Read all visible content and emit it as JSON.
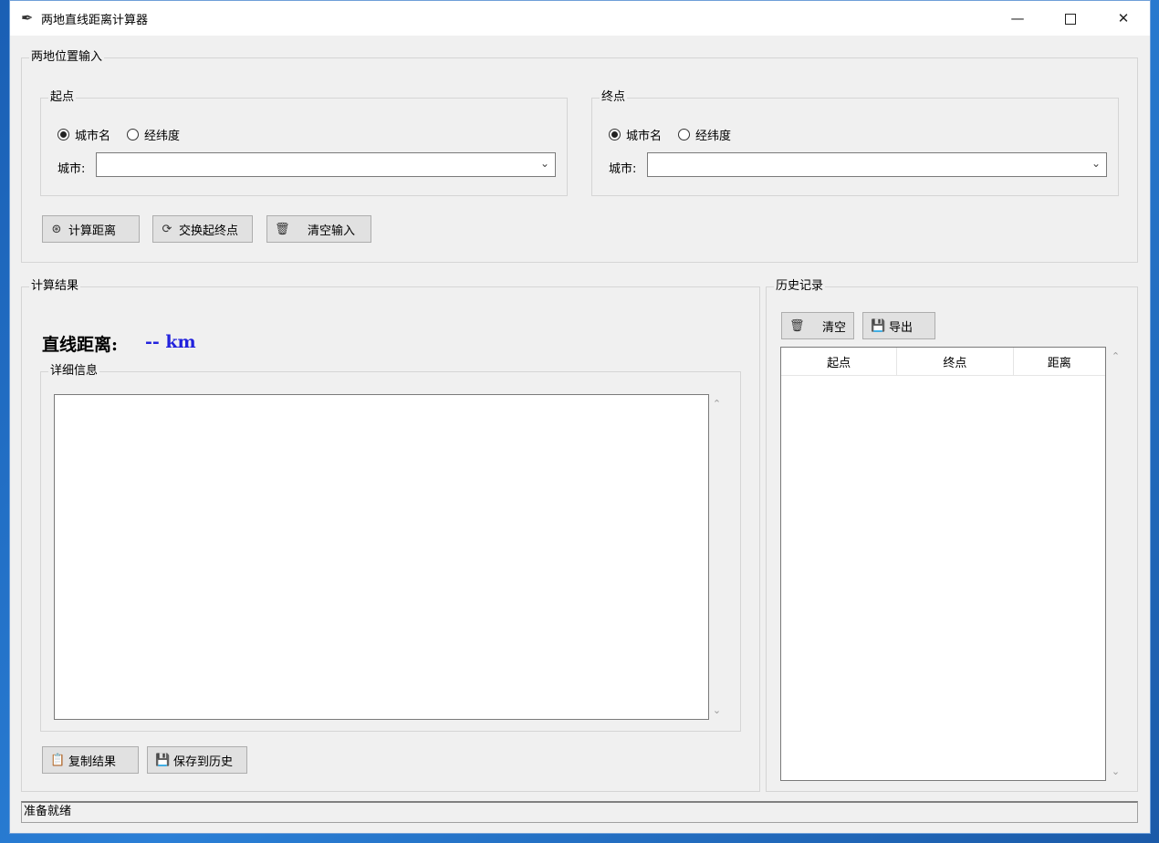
{
  "window": {
    "title": "两地直线距离计算器",
    "controls": {
      "minimize": "—",
      "maximize": "□",
      "close": "✕"
    }
  },
  "input_section": {
    "legend": "两地位置输入",
    "start": {
      "legend": "起点",
      "radio_city": "城市名",
      "radio_coords": "经纬度",
      "selected_mode": "城市名",
      "field_label": "城市:",
      "value": ""
    },
    "end": {
      "legend": "终点",
      "radio_city": "城市名",
      "radio_coords": "经纬度",
      "selected_mode": "城市名",
      "field_label": "城市:",
      "value": ""
    },
    "buttons": {
      "calculate": "计算距离",
      "swap": "交换起终点",
      "clear": "清空输入"
    }
  },
  "result_section": {
    "legend": "计算结果",
    "distance_label": "直线距离:",
    "distance_value": "-- km",
    "details_legend": "详细信息",
    "details_text": "",
    "buttons": {
      "copy": "复制结果",
      "save": "保存到历史"
    }
  },
  "history_section": {
    "legend": "历史记录",
    "buttons": {
      "clear": "清空",
      "export": "导出"
    },
    "columns": [
      "起点",
      "终点",
      "距离"
    ],
    "rows": []
  },
  "status": "准备就绪",
  "icons": {
    "app": "feather-icon",
    "calculate": "compass-icon",
    "swap": "swap-icon",
    "clear": "trash-icon",
    "copy": "clipboard-icon",
    "save": "floppy-icon"
  }
}
